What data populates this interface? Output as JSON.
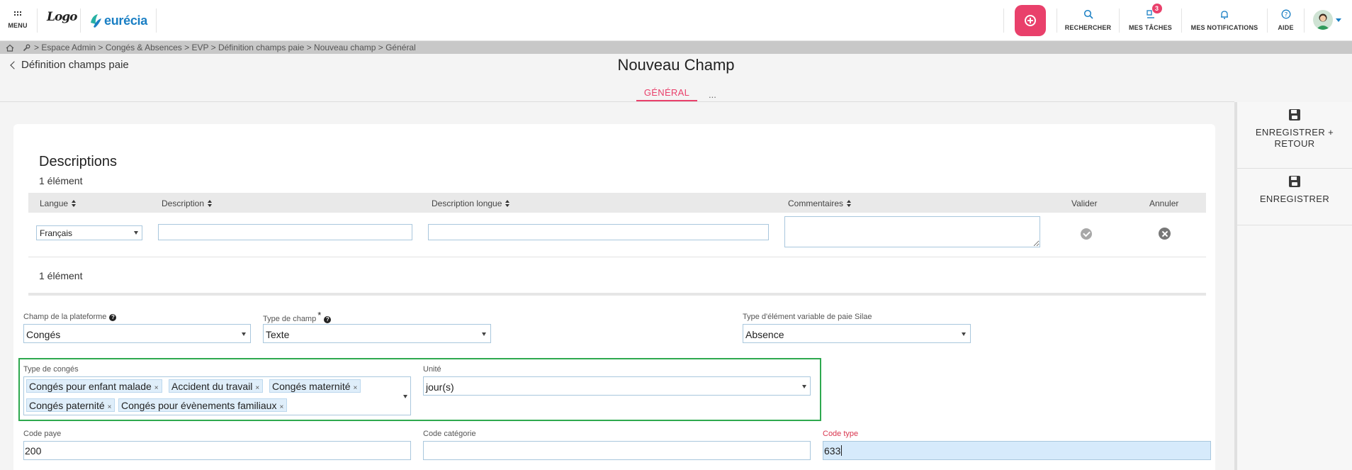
{
  "header": {
    "menu_label": "MENU",
    "logo_text": "Logo",
    "brand_name": "eurécia",
    "nav": [
      {
        "label": "RECHERCHER",
        "icon": "search-icon"
      },
      {
        "label": "MES TÂCHES",
        "icon": "tasks-icon",
        "badge": "3"
      },
      {
        "label": "MES NOTIFICATIONS",
        "icon": "bell-icon"
      },
      {
        "label": "AIDE",
        "icon": "help-icon"
      }
    ]
  },
  "breadcrumb": {
    "text": "> Espace Admin > Congés & Absences > EVP > Définition champs paie > Nouveau champ > Général"
  },
  "page": {
    "back_label": "Définition champs paie",
    "title": "Nouveau Champ",
    "tabs": [
      "GÉNÉRAL",
      "..."
    ]
  },
  "actions": {
    "save_return_line1": "ENREGISTRER +",
    "save_return_line2": "RETOUR",
    "save_label": "ENREGISTRER"
  },
  "descriptions": {
    "title": "Descriptions",
    "count_top": "1 élément",
    "count_bottom": "1 élément",
    "columns": {
      "langue": "Langue",
      "description": "Description",
      "description_longue": "Description longue",
      "commentaires": "Commentaires",
      "valider": "Valider",
      "annuler": "Annuler"
    },
    "row": {
      "langue": "Français",
      "description": "",
      "description_longue": "",
      "commentaires": ""
    }
  },
  "form": {
    "champ_plateforme": {
      "label": "Champ de la plateforme",
      "value": "Congés"
    },
    "type_champ": {
      "label": "Type de champ",
      "required_mark": "*",
      "value": "Texte"
    },
    "type_element": {
      "label": "Type d'élément variable de paie Silae",
      "value": "Absence"
    },
    "type_conges": {
      "label": "Type de congés",
      "chips": [
        "Congés pour enfant malade",
        "Accident du travail",
        "Congés maternité",
        "Congés paternité",
        "Congés pour évènements familiaux"
      ],
      "remove_glyph": "×"
    },
    "unite": {
      "label": "Unité",
      "value": "jour(s)"
    },
    "code_paye": {
      "label": "Code paye",
      "value": "200"
    },
    "code_categorie": {
      "label": "Code catégorie",
      "value": ""
    },
    "code_type": {
      "label": "Code type",
      "value": "633"
    }
  },
  "colors": {
    "accent": "#e9406b",
    "brand_blue": "#1a7fc4",
    "highlight_green": "#2ea94f",
    "active_input_bg": "#d6eafb"
  }
}
